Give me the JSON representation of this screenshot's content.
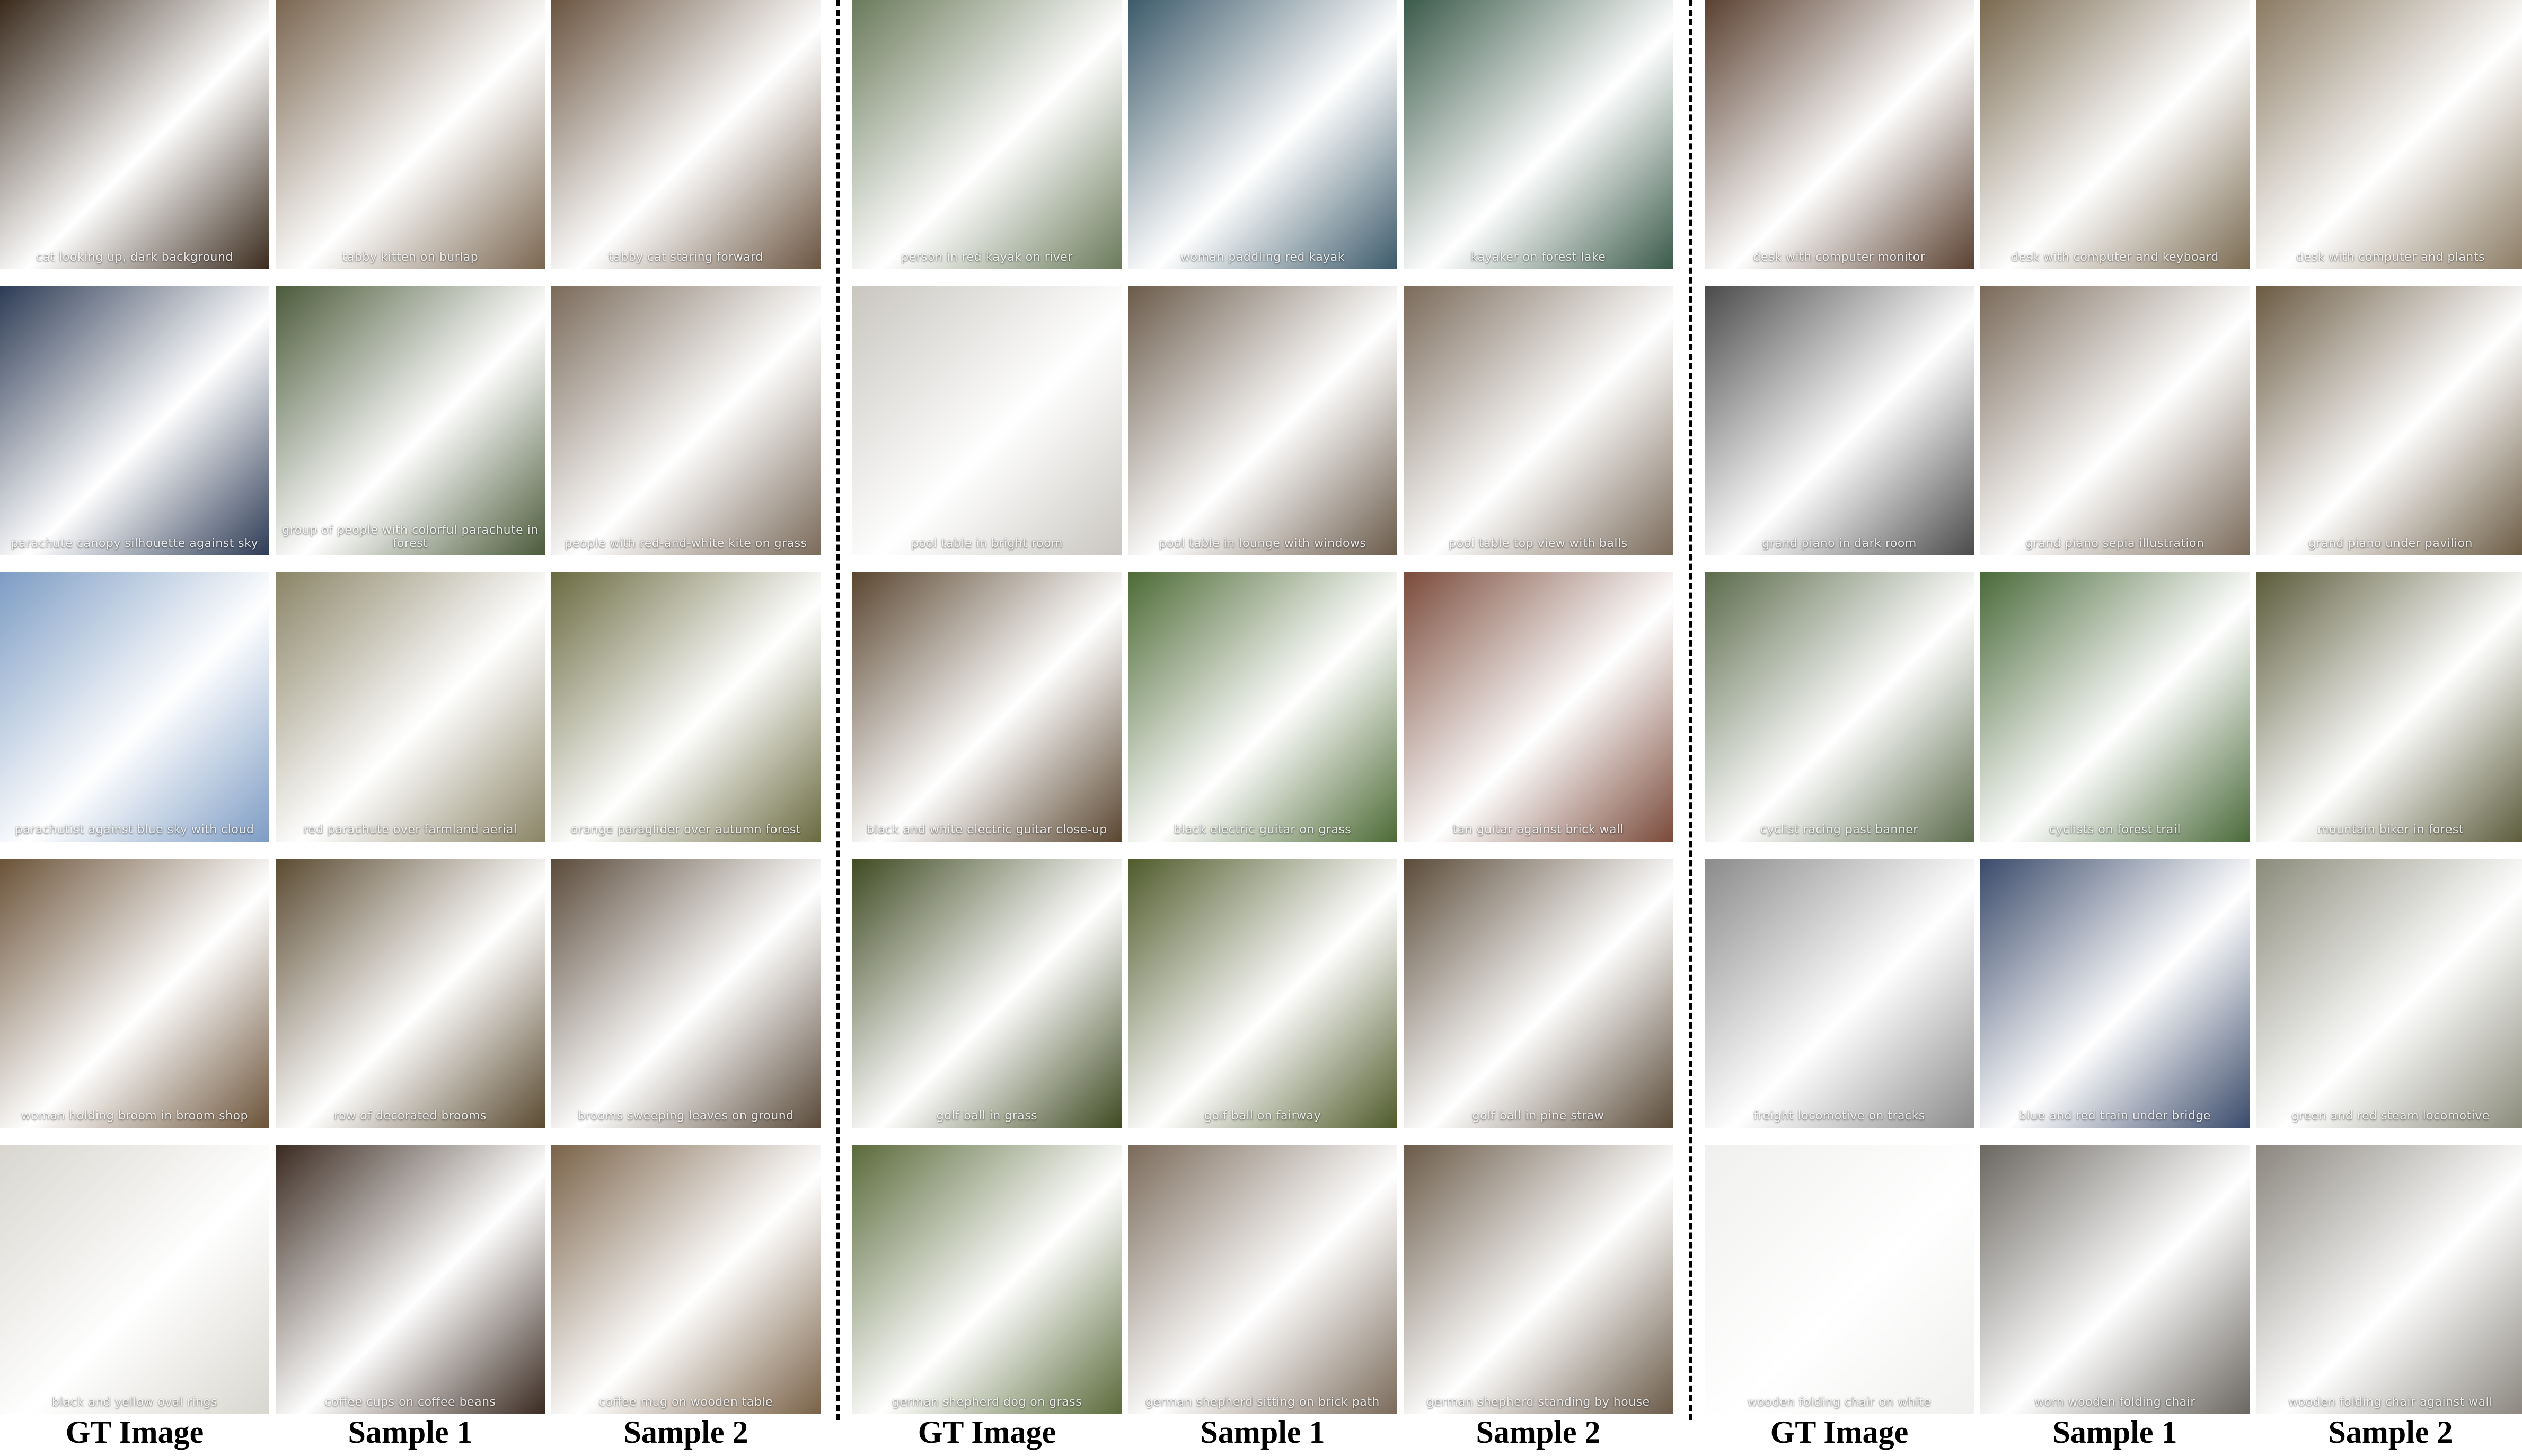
{
  "groups": [
    {
      "captions": [
        "GT Image",
        "Sample 1",
        "Sample 2"
      ],
      "rows": [
        [
          "cat looking up, dark background",
          "tabby kitten on burlap",
          "tabby cat staring forward"
        ],
        [
          "parachute canopy silhouette against sky",
          "group of people with colorful parachute in forest",
          "people with red-and-white kite on grass"
        ],
        [
          "parachutist against blue sky with cloud",
          "red parachute over farmland aerial",
          "orange paraglider over autumn forest"
        ],
        [
          "woman holding broom in broom shop",
          "row of decorated brooms",
          "brooms sweeping leaves on ground"
        ],
        [
          "black and yellow oval rings",
          "coffee cups on coffee beans",
          "coffee mug on wooden table"
        ]
      ]
    },
    {
      "captions": [
        "GT Image",
        "Sample 1",
        "Sample 2"
      ],
      "rows": [
        [
          "person in red kayak on river",
          "woman paddling red kayak",
          "kayaker on forest lake"
        ],
        [
          "pool table in bright room",
          "pool table in lounge with windows",
          "pool table top view with balls"
        ],
        [
          "black and white electric guitar close-up",
          "black electric guitar on grass",
          "tan guitar against brick wall"
        ],
        [
          "golf ball in grass",
          "golf ball on fairway",
          "golf ball in pine straw"
        ],
        [
          "german shepherd dog on grass",
          "german shepherd sitting on brick path",
          "german shepherd standing by house"
        ]
      ]
    },
    {
      "captions": [
        "GT Image",
        "Sample 1",
        "Sample 2"
      ],
      "rows": [
        [
          "desk with computer monitor",
          "desk with computer and keyboard",
          "desk with computer and plants"
        ],
        [
          "grand piano in dark room",
          "grand piano sepia illustration",
          "grand piano under pavilion"
        ],
        [
          "cyclist racing past banner",
          "cyclists on forest trail",
          "mountain biker in forest"
        ],
        [
          "freight locomotive on tracks",
          "blue and red train under bridge",
          "green and red steam locomotive"
        ],
        [
          "wooden folding chair on white",
          "worn wooden folding chair",
          "wooden folding chair against wall"
        ]
      ]
    }
  ],
  "colors": {
    "g0": [
      [
        "#3a2a1c",
        "#7a6650",
        "#6a5440"
      ],
      [
        "#2d3b55",
        "#4b5a3a",
        "#7a6a5a"
      ],
      [
        "#7d9cc4",
        "#8a8466",
        "#6a6a40"
      ],
      [
        "#6b5238",
        "#5a4a30",
        "#5a4a3a"
      ],
      [
        "#d8d6cf",
        "#3a2a20",
        "#7a6248"
      ]
    ],
    "g1": [
      [
        "#6a7a5a",
        "#3c5a6a",
        "#3a5a4a"
      ],
      [
        "#c9c6c0",
        "#6a5a4a",
        "#7a6a5a"
      ],
      [
        "#5a4630",
        "#4d6a35",
        "#7a4a3a"
      ],
      [
        "#3f4a22",
        "#4f5a2a",
        "#5a4a38"
      ],
      [
        "#5a6a3a",
        "#7a6a5a",
        "#6a5a48"
      ]
    ],
    "g2": [
      [
        "#5a4030",
        "#7a6a50",
        "#8a7a62"
      ],
      [
        "#4a4a4a",
        "#7a6a5a",
        "#6a5a42"
      ],
      [
        "#5a6a4a",
        "#4a6a3a",
        "#5a5a3a"
      ],
      [
        "#8a8a8a",
        "#3a4a6a",
        "#8a8a7a"
      ],
      [
        "#f0f0ee",
        "#6a6660",
        "#8a867e"
      ]
    ]
  }
}
